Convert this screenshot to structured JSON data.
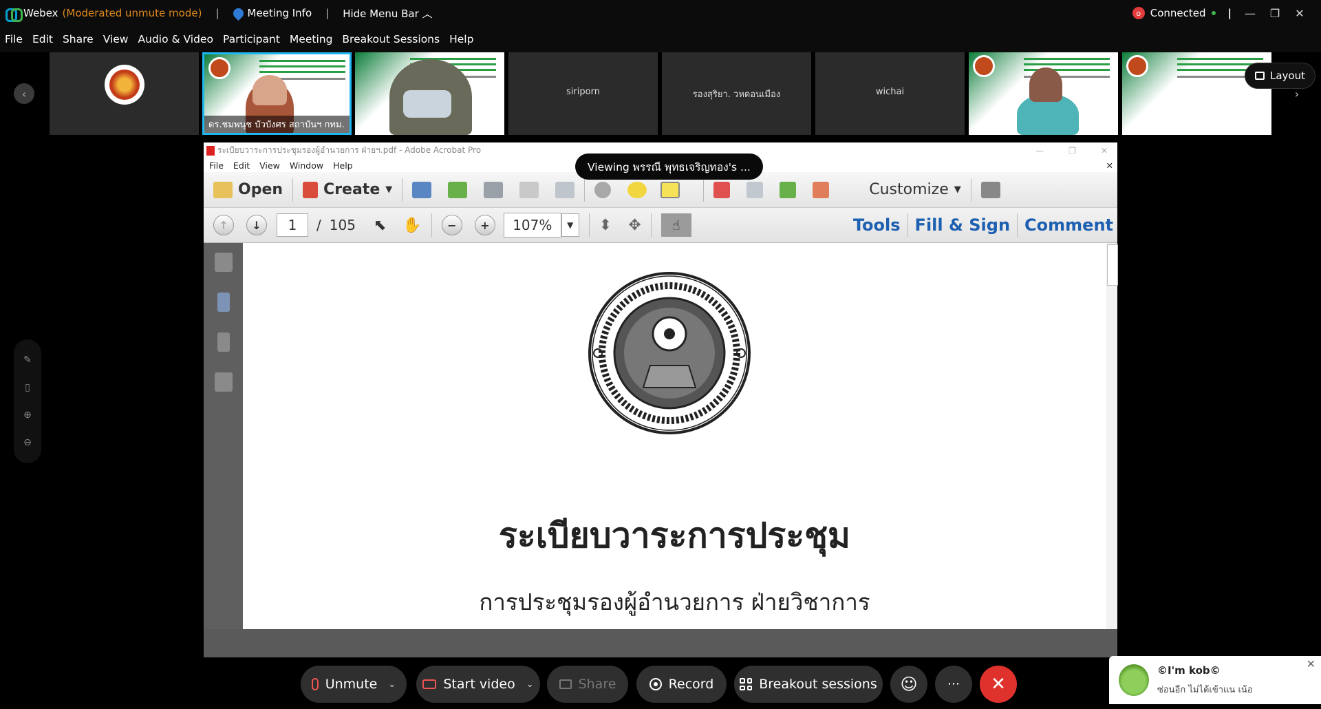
{
  "titlebar": {
    "app": "Webex",
    "mode": "(Moderated unmute mode)",
    "meeting_info": "Meeting Info",
    "hide_menu": "Hide Menu Bar",
    "status": "Connected",
    "rec_badge": "o"
  },
  "menu": [
    "File",
    "Edit",
    "Share",
    "View",
    "Audio & Video",
    "Participant",
    "Meeting",
    "Breakout Sessions",
    "Help"
  ],
  "participants": {
    "tile_2_caption": "ดร.ชมพนุช บัวบังศร สถาบันฯ กทม.",
    "tile_4_name": "siriporn",
    "tile_5_name": "รองสุริยา. วหดอนเมือง",
    "tile_6_name": "wichai"
  },
  "layout_label": "Layout",
  "viewing_label": "Viewing พรรณี พุทธเจริญทอง's ...",
  "acrobat": {
    "window_title": "ระเบียบวาระการประชุมรองผู้อำนวยการ ฝ่ายฯ.pdf - Adobe Acrobat Pro",
    "menu": [
      "File",
      "Edit",
      "View",
      "Window",
      "Help"
    ],
    "open_label": "Open",
    "create_label": "Create",
    "customize_label": "Customize",
    "page_current": "1",
    "page_sep": "/",
    "page_total": "105",
    "zoom": "107%",
    "tools_label": "Tools",
    "fill_sign_label": "Fill & Sign",
    "comment_label": "Comment",
    "doc_title": "ระเบียบวาระการประชุม",
    "doc_subtitle": "การประชุมรองผู้อำนวยการ ฝ่ายวิชาการ"
  },
  "controls": {
    "unmute": "Unmute",
    "start_video": "Start video",
    "share": "Share",
    "record": "Record",
    "breakout": "Breakout sessions",
    "more": "···",
    "end": "✕"
  },
  "notification": {
    "name": "©I'm kob©",
    "message": "ซ่อนอีก ไม่ได้เข้าแน เน้อ"
  },
  "colors": {
    "accent_blue": "#1db7f2",
    "end_red": "#e0322d",
    "mode_orange": "#e08a1e",
    "link_blue": "#1d5fb0"
  }
}
